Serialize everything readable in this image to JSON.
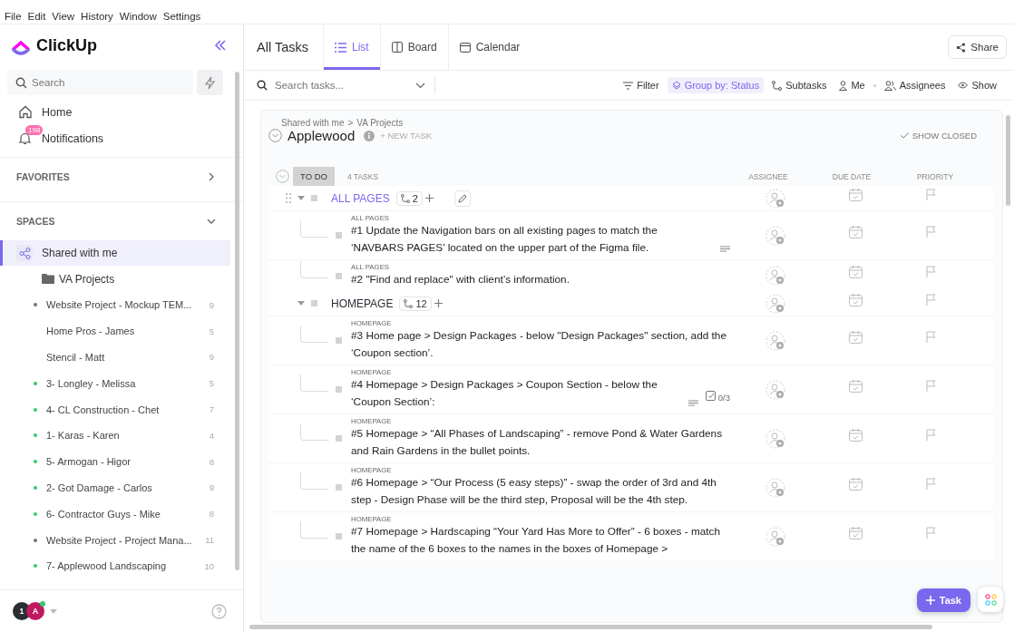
{
  "menu_bar": [
    "File",
    "Edit",
    "View",
    "History",
    "Window",
    "Settings"
  ],
  "sidebar": {
    "logo": "ClickUp",
    "search": {
      "placeholder": "Search"
    },
    "nav": [
      {
        "label": "Home"
      },
      {
        "label": "Notifications",
        "badge": "198"
      }
    ],
    "sections": [
      {
        "label": "FAVORITES",
        "expanded": false
      },
      {
        "label": "SPACES",
        "expanded": true
      }
    ],
    "space": {
      "label": "Shared with me",
      "selected": true
    },
    "folder": "VA Projects",
    "lists": [
      {
        "label": "Website Project - Mockup TEM...",
        "count": "9",
        "color": "#6b7280"
      },
      {
        "label": "Home Pros - James",
        "count": "5"
      },
      {
        "label": "Stencil - Matt",
        "count": "9"
      },
      {
        "label": "3- Longley - Melissa",
        "count": "5",
        "color": "#2ecc71"
      },
      {
        "label": "4- CL Construction - Chet",
        "count": "7",
        "color": "#2ecc71"
      },
      {
        "label": "1- Karas - Karen",
        "count": "4",
        "color": "#2ecc71"
      },
      {
        "label": "5- Armogan - Higor",
        "count": "8",
        "color": "#2ecc71"
      },
      {
        "label": "2- Got Damage - Carlos",
        "count": "9",
        "color": "#2ecc71"
      },
      {
        "label": "6- Contractor Guys - Mike",
        "count": "8",
        "color": "#2ecc71"
      },
      {
        "label": "Website Project - Project Mana...",
        "count": "11",
        "color": "#6b7280"
      },
      {
        "label": "7- Applewood Landscaping",
        "count": "10",
        "color": "#2ecc71"
      }
    ],
    "avatars": [
      "1",
      "A"
    ]
  },
  "header": {
    "title": "All Tasks",
    "views": [
      {
        "label": "List",
        "selected": true
      },
      {
        "label": "Board",
        "selected": false
      },
      {
        "label": "Calendar",
        "selected": false
      }
    ],
    "share": "Share"
  },
  "toolbar": {
    "search": {
      "placeholder": "Search tasks..."
    },
    "filter": "Filter",
    "group_by": "Group by: Status",
    "subtasks": "Subtasks",
    "me": "Me",
    "assignees": "Assignees",
    "show": "Show"
  },
  "list": {
    "breadcrumb": [
      "Shared with me",
      "VA Projects"
    ],
    "breadcrumb_separator": ">",
    "title": "Applewood",
    "new_task": "+ NEW TASK",
    "show_closed": "SHOW CLOSED",
    "status": {
      "label": "TO DO",
      "count": "4 TASKS"
    },
    "columns": [
      "ASSIGNEE",
      "DUE DATE",
      "PRIORITY"
    ],
    "groups": [
      {
        "title": "ALL PAGES",
        "subtasks": "2",
        "highlighted": true,
        "tasks": [
          {
            "parent": "ALL PAGES",
            "text": "#1 Update the Navigation bars on all existing pages to match the ‘NAVBARS PAGES’ located on the upper part of the Figma file.",
            "description": true
          },
          {
            "parent": "ALL PAGES",
            "text": "#2 \"Find and replace\" with client’s information.",
            "description": false
          }
        ]
      },
      {
        "title": "HOMEPAGE",
        "subtasks": "12",
        "highlighted": false,
        "tasks": [
          {
            "parent": "HOMEPAGE",
            "text": "#3 Home page > Design Packages - below \"Design Packages\" section, add the ‘Coupon section’.",
            "description": false
          },
          {
            "parent": "HOMEPAGE",
            "text": "#4 Homepage > Design Packages > Coupon Section - below the ‘Coupon Section’:",
            "description": true,
            "checklist": "0/3"
          },
          {
            "parent": "HOMEPAGE",
            "text": "#5 Homepage > “All Phases of Landscaping” - remove Pond & Water Gardens and Rain Gardens in the bullet points.",
            "description": false
          },
          {
            "parent": "HOMEPAGE",
            "text": "#6 Homepage > “Our Process (5 easy steps)” - swap the order of 3rd and 4th step - Design Phase will be the third step, Proposal will be the 4th step.",
            "description": false
          },
          {
            "parent": "HOMEPAGE",
            "text": "#7 Homepage > Hardscaping “Your Yard Has More to Offer” - 6 boxes - match the name of the 6 boxes to the names in the boxes of Homepage >",
            "description": false
          }
        ]
      }
    ]
  },
  "fab": "Task"
}
